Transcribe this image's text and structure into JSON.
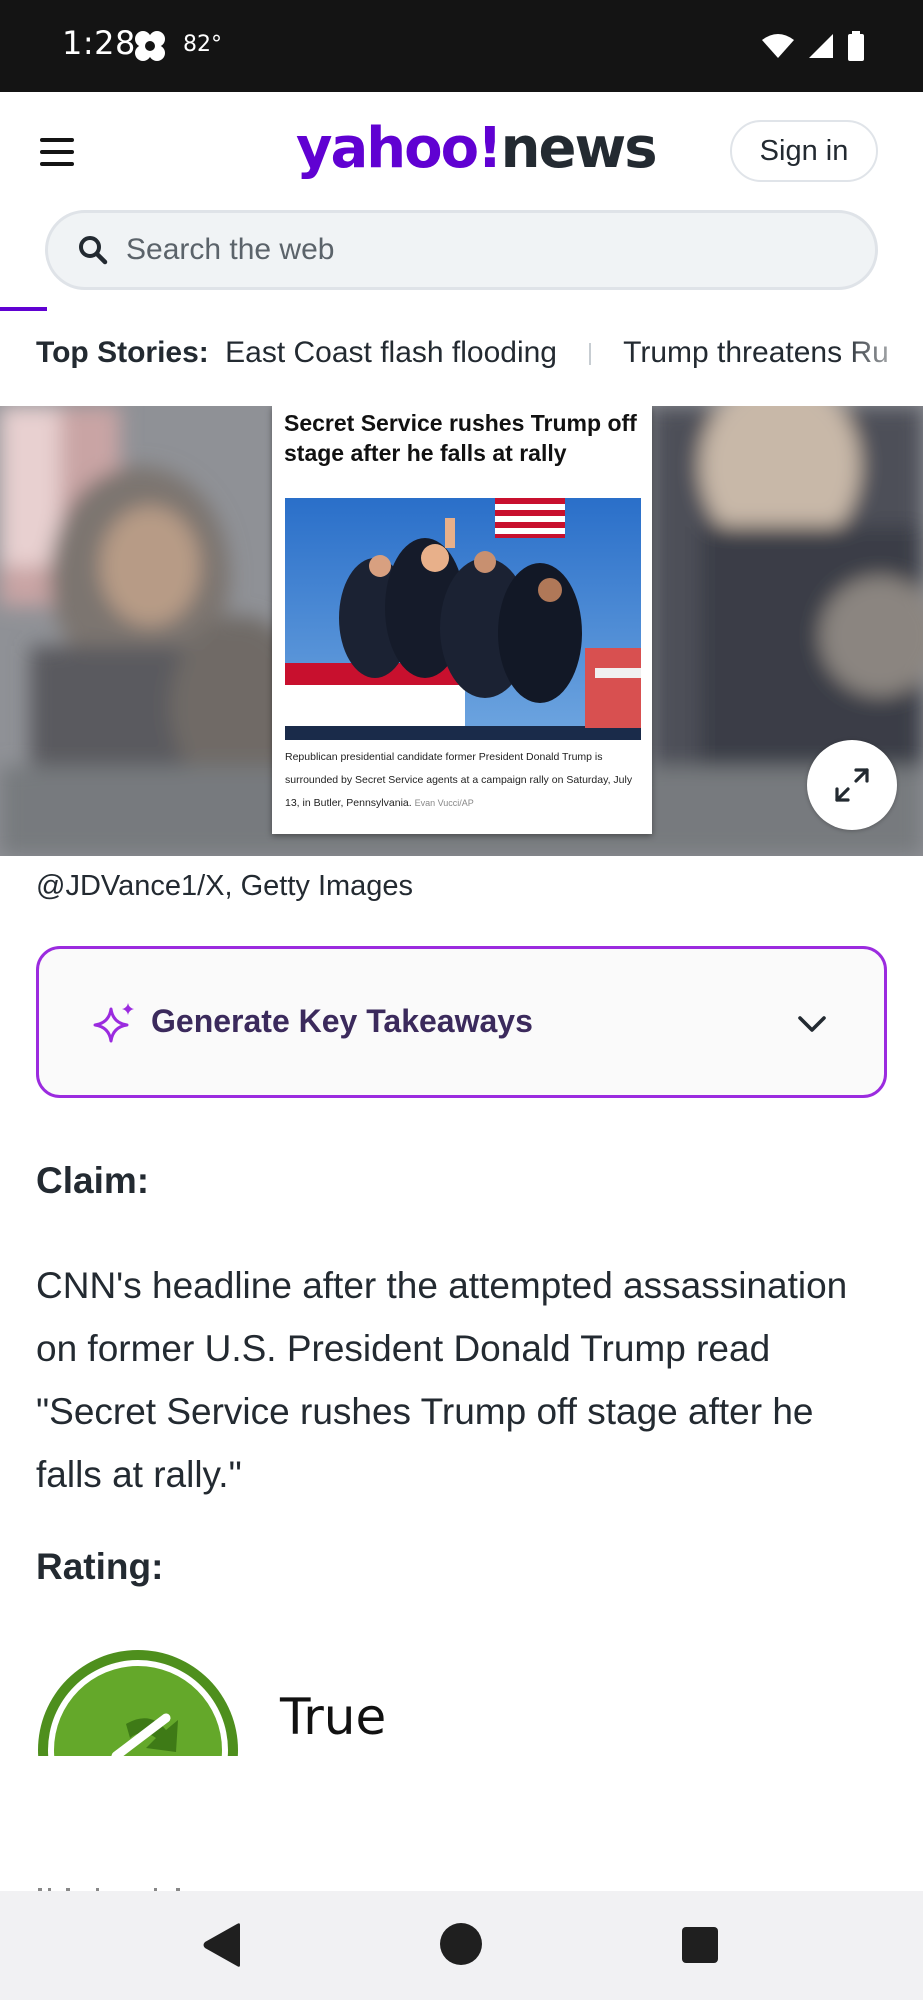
{
  "status_bar": {
    "time": "1:28",
    "temperature": "82°",
    "icons": [
      "app-notification-icon",
      "wifi-icon",
      "signal-icon",
      "battery-icon"
    ]
  },
  "header": {
    "logo_yahoo": "yahoo!",
    "logo_news": "news",
    "sign_in_label": "Sign in",
    "brand_color": "#6001d2"
  },
  "search": {
    "placeholder": "Search the web"
  },
  "top_stories": {
    "label": "Top Stories:",
    "items": [
      "East Coast flash flooding",
      "Trump threatens Ru"
    ]
  },
  "hero": {
    "headline": "Secret Service rushes Trump off stage after he falls at rally",
    "caption": "Republican presidential candidate former President Donald Trump is surrounded by Secret Service agents at a campaign rally on Saturday, July 13, in Butler, Pennsylvania.",
    "caption_credit": "Evan Vucci/AP",
    "photo_credit": "@JDVance1/X, Getty Images"
  },
  "takeaways": {
    "label": "Generate Key Takeaways",
    "accent_color": "#9b2bdf"
  },
  "article": {
    "claim_heading": "Claim:",
    "claim_text": "CNN's headline after the attempted assassination on former U.S. President Donald Trump read \"Secret Service rushes Trump off stage after he falls at rally.\"",
    "rating_heading": "Rating:",
    "rating_value": "True",
    "rating_color": "#4e8f1d"
  },
  "nav_bar": {
    "buttons": [
      "back-icon",
      "home-icon",
      "recents-icon"
    ]
  }
}
